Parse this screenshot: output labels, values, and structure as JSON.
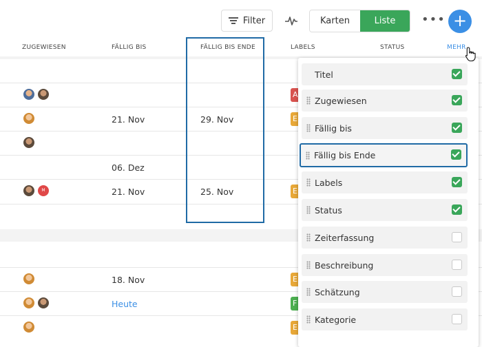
{
  "toolbar": {
    "filter_label": "Filter",
    "view_karten": "Karten",
    "view_liste": "Liste",
    "more_dots": "•••",
    "add_symbol": "+"
  },
  "columns": {
    "zugewiesen": "ZUGEWIESEN",
    "faellig_bis": "FÄLLIG BIS",
    "faellig_bis_ende": "FÄLLIG BIS ENDE",
    "labels": "LABELS",
    "status": "STATUS",
    "mehr": "MEHR"
  },
  "rows": [
    {
      "faellig_bis": "",
      "faellig_bis_ende": "",
      "label_letter": "A"
    },
    {
      "faellig_bis": "21. Nov",
      "faellig_bis_ende": "29. Nov",
      "label_letter": "E"
    },
    {
      "faellig_bis": "",
      "faellig_bis_ende": "",
      "label_letter": ""
    },
    {
      "faellig_bis": "06. Dez",
      "faellig_bis_ende": "",
      "label_letter": ""
    },
    {
      "faellig_bis": "21. Nov",
      "faellig_bis_ende": "25. Nov",
      "label_letter": "E",
      "avatar_initial": "M"
    },
    {
      "faellig_bis": "18. Nov",
      "faellig_bis_ende": "",
      "label_letter": "E"
    },
    {
      "faellig_bis": "Heute",
      "faellig_bis_ende": "",
      "label_letter": "F"
    },
    {
      "faellig_bis": "",
      "faellig_bis_ende": "",
      "label_letter": "E"
    }
  ],
  "column_menu": [
    {
      "label": "Titel",
      "checked": true
    },
    {
      "label": "Zugewiesen",
      "checked": true
    },
    {
      "label": "Fällig bis",
      "checked": true
    },
    {
      "label": "Fällig bis Ende",
      "checked": true
    },
    {
      "label": "Labels",
      "checked": true
    },
    {
      "label": "Status",
      "checked": true
    },
    {
      "label": "Zeiterfassung",
      "checked": false
    },
    {
      "label": "Beschreibung",
      "checked": false
    },
    {
      "label": "Schätzung",
      "checked": false
    },
    {
      "label": "Kategorie",
      "checked": false
    }
  ],
  "colors": {
    "accent_green": "#3aa65a",
    "accent_blue": "#3b8fe5",
    "highlight_border": "#1f6aa5",
    "label_red": "#d9534f",
    "label_orange": "#e8a838",
    "label_green": "#4caf50"
  }
}
